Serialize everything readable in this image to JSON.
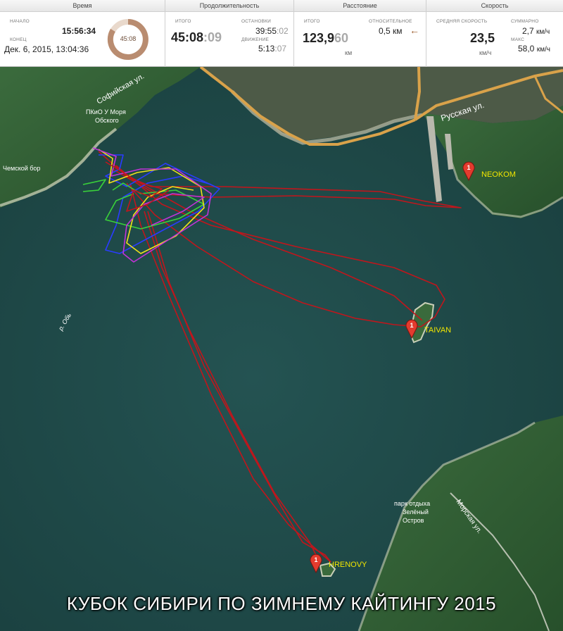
{
  "stats": {
    "time": {
      "header": "Время",
      "start_label": "НАЧАЛО",
      "start_value": "15:56:34",
      "end_label": "КОНЕЦ",
      "end_value": "Дек. 6, 2015, 13:04:36",
      "dial_value": "45:08"
    },
    "duration": {
      "header": "Продолжительность",
      "total_label": "ИТОГО",
      "total_main": "45:08",
      "total_frac": ":09",
      "stops_label": "ОСТАНОВКИ",
      "stops_main": "39:55",
      "stops_frac": ":02",
      "moving_label": "ДВИЖЕНИЕ",
      "moving_main": "5:13",
      "moving_frac": ":07"
    },
    "distance": {
      "header": "Расстояние",
      "total_label": "ИТОГО",
      "total_main": "123,9",
      "total_frac": "60",
      "total_unit": "км",
      "relative_label": "ОТНОСИТЕЛЬНОЕ",
      "relative_value": "0,5 км",
      "relative_arrow": "←"
    },
    "speed": {
      "header": "Скорость",
      "avg_label": "СРЕДНЯЯ СКОРОСТЬ",
      "avg_value": "23,5",
      "avg_unit": "км/ч",
      "total_label": "СУММАРНО",
      "total_value": "2,7",
      "total_unit": "км/ч",
      "max_label": "МАКС",
      "max_value": "58,0",
      "max_unit": "км/ч"
    }
  },
  "map": {
    "labels": {
      "sofiyskaya": "Софийская ул.",
      "pkio": "ПКиО У Моря",
      "obskogo": "Обского",
      "chemskoy": "Чемской бор",
      "russkaya": "Русская ул.",
      "river": "р. Обь",
      "park1": "парк отдыха",
      "park2": "Зелёный",
      "park3": "Остров",
      "morskaya": "Морская ул."
    },
    "markers": [
      {
        "number": "1",
        "name": "NEOKOM"
      },
      {
        "number": "1",
        "name": "TAIVAN"
      },
      {
        "number": "1",
        "name": "HRENOVY"
      }
    ],
    "colors": {
      "water": "#1f4a49",
      "forest": "#2e5a33",
      "road": "#d9a24a",
      "track_red": "#c0161c",
      "track_blue": "#2a3cff",
      "track_green": "#3ad23a",
      "track_yellow": "#f0e21a",
      "track_magenta": "#c233d8"
    }
  },
  "banner": "КУБОК СИБИРИ ПО ЗИМНЕМУ КАЙТИНГУ 2015"
}
